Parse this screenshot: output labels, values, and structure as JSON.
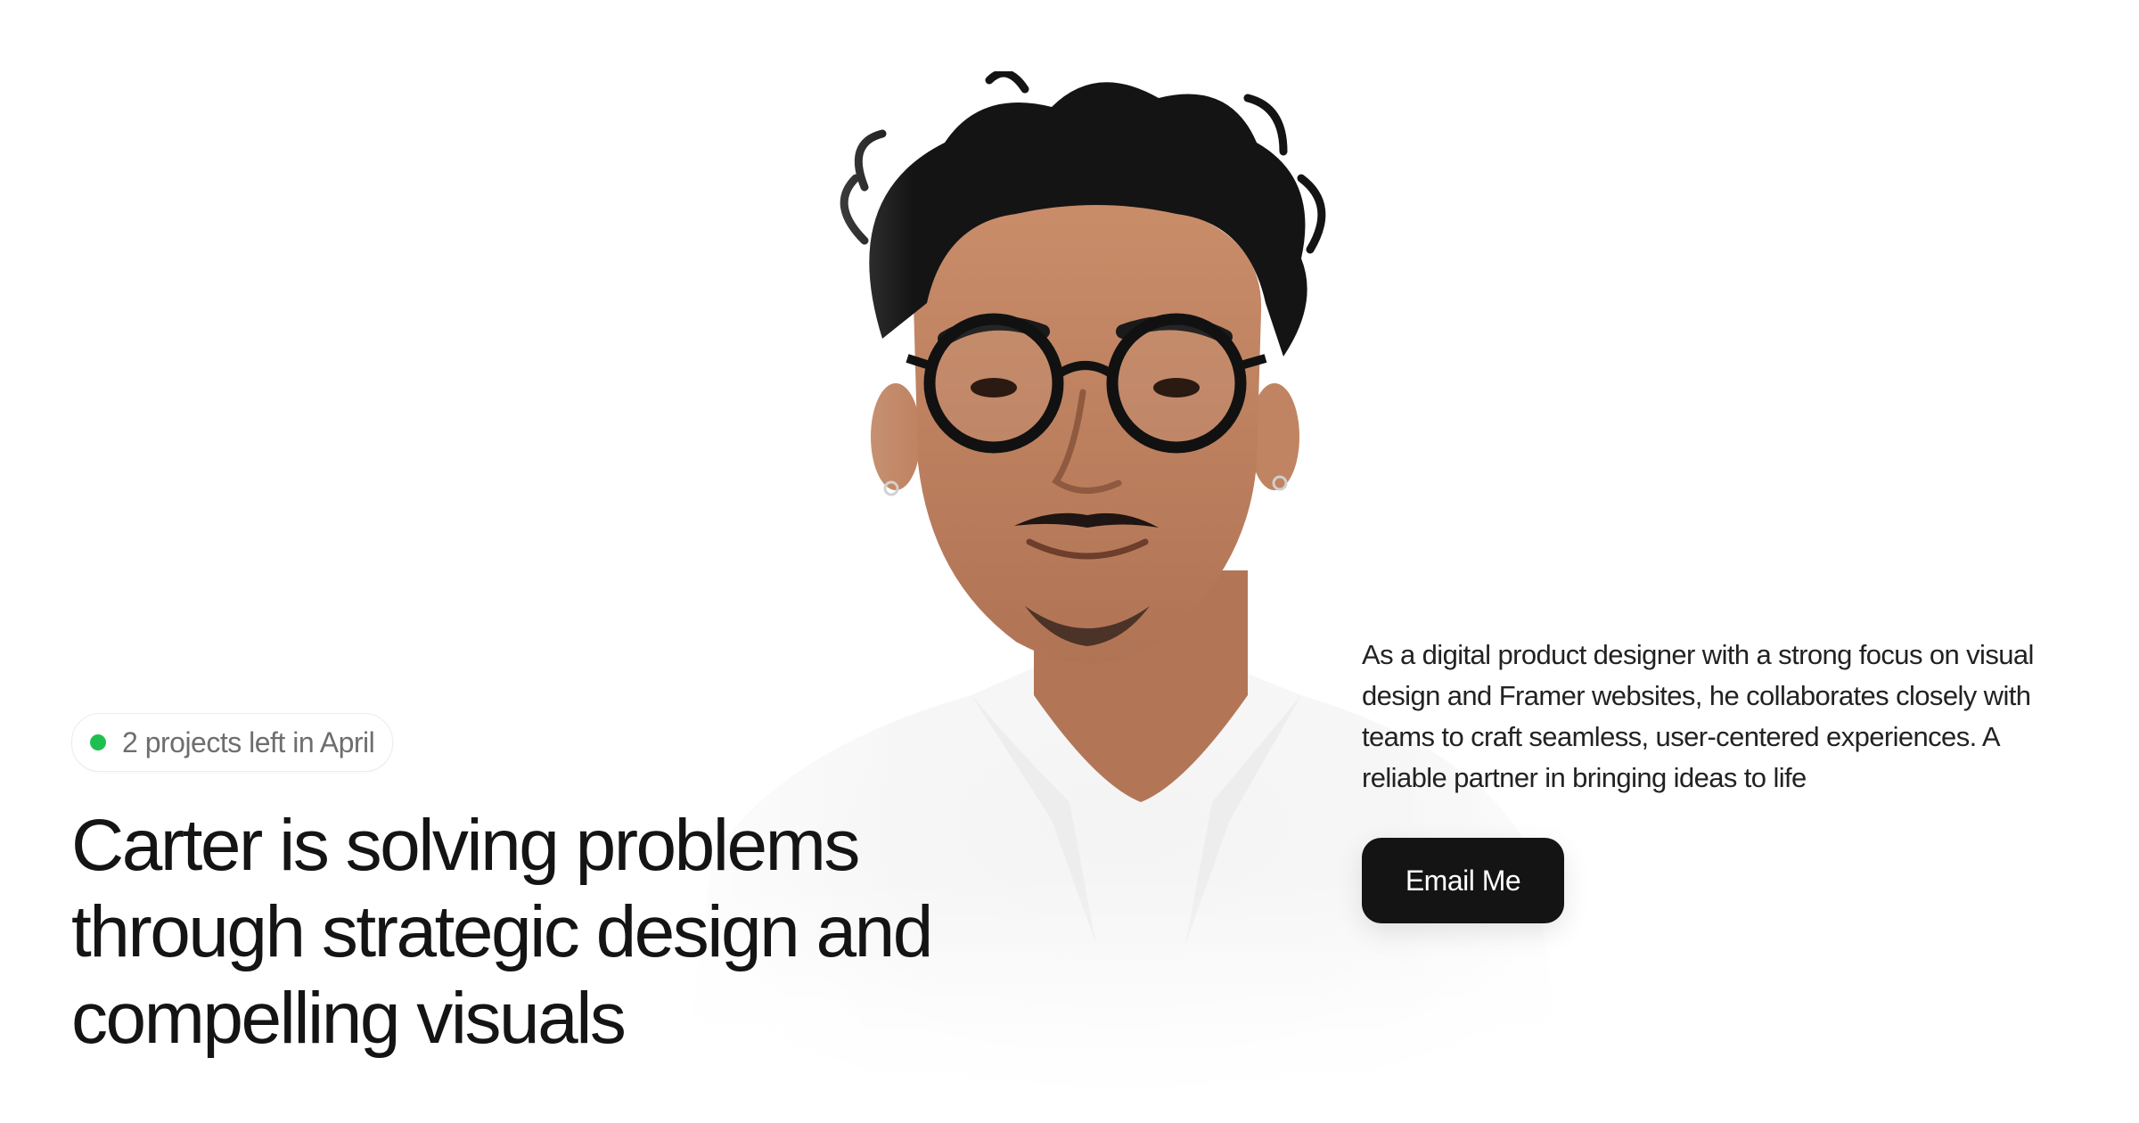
{
  "availability": {
    "text": "2 projects left in April",
    "status_color": "#1fbf4f",
    "status_icon": "status-dot-icon"
  },
  "hero": {
    "headline": "Carter is solving problems through strategic design and compelling visuals",
    "bio": "As a digital product designer with a strong focus on visual design and Framer websites, he collaborates closely with teams to craft seamless, user-centered experiences. A reliable partner in bringing ideas to life",
    "cta_label": "Email Me",
    "cta_color": "#141414"
  },
  "portrait": {
    "subject": "smiling man with curly hair, round black glasses, white shirt"
  }
}
